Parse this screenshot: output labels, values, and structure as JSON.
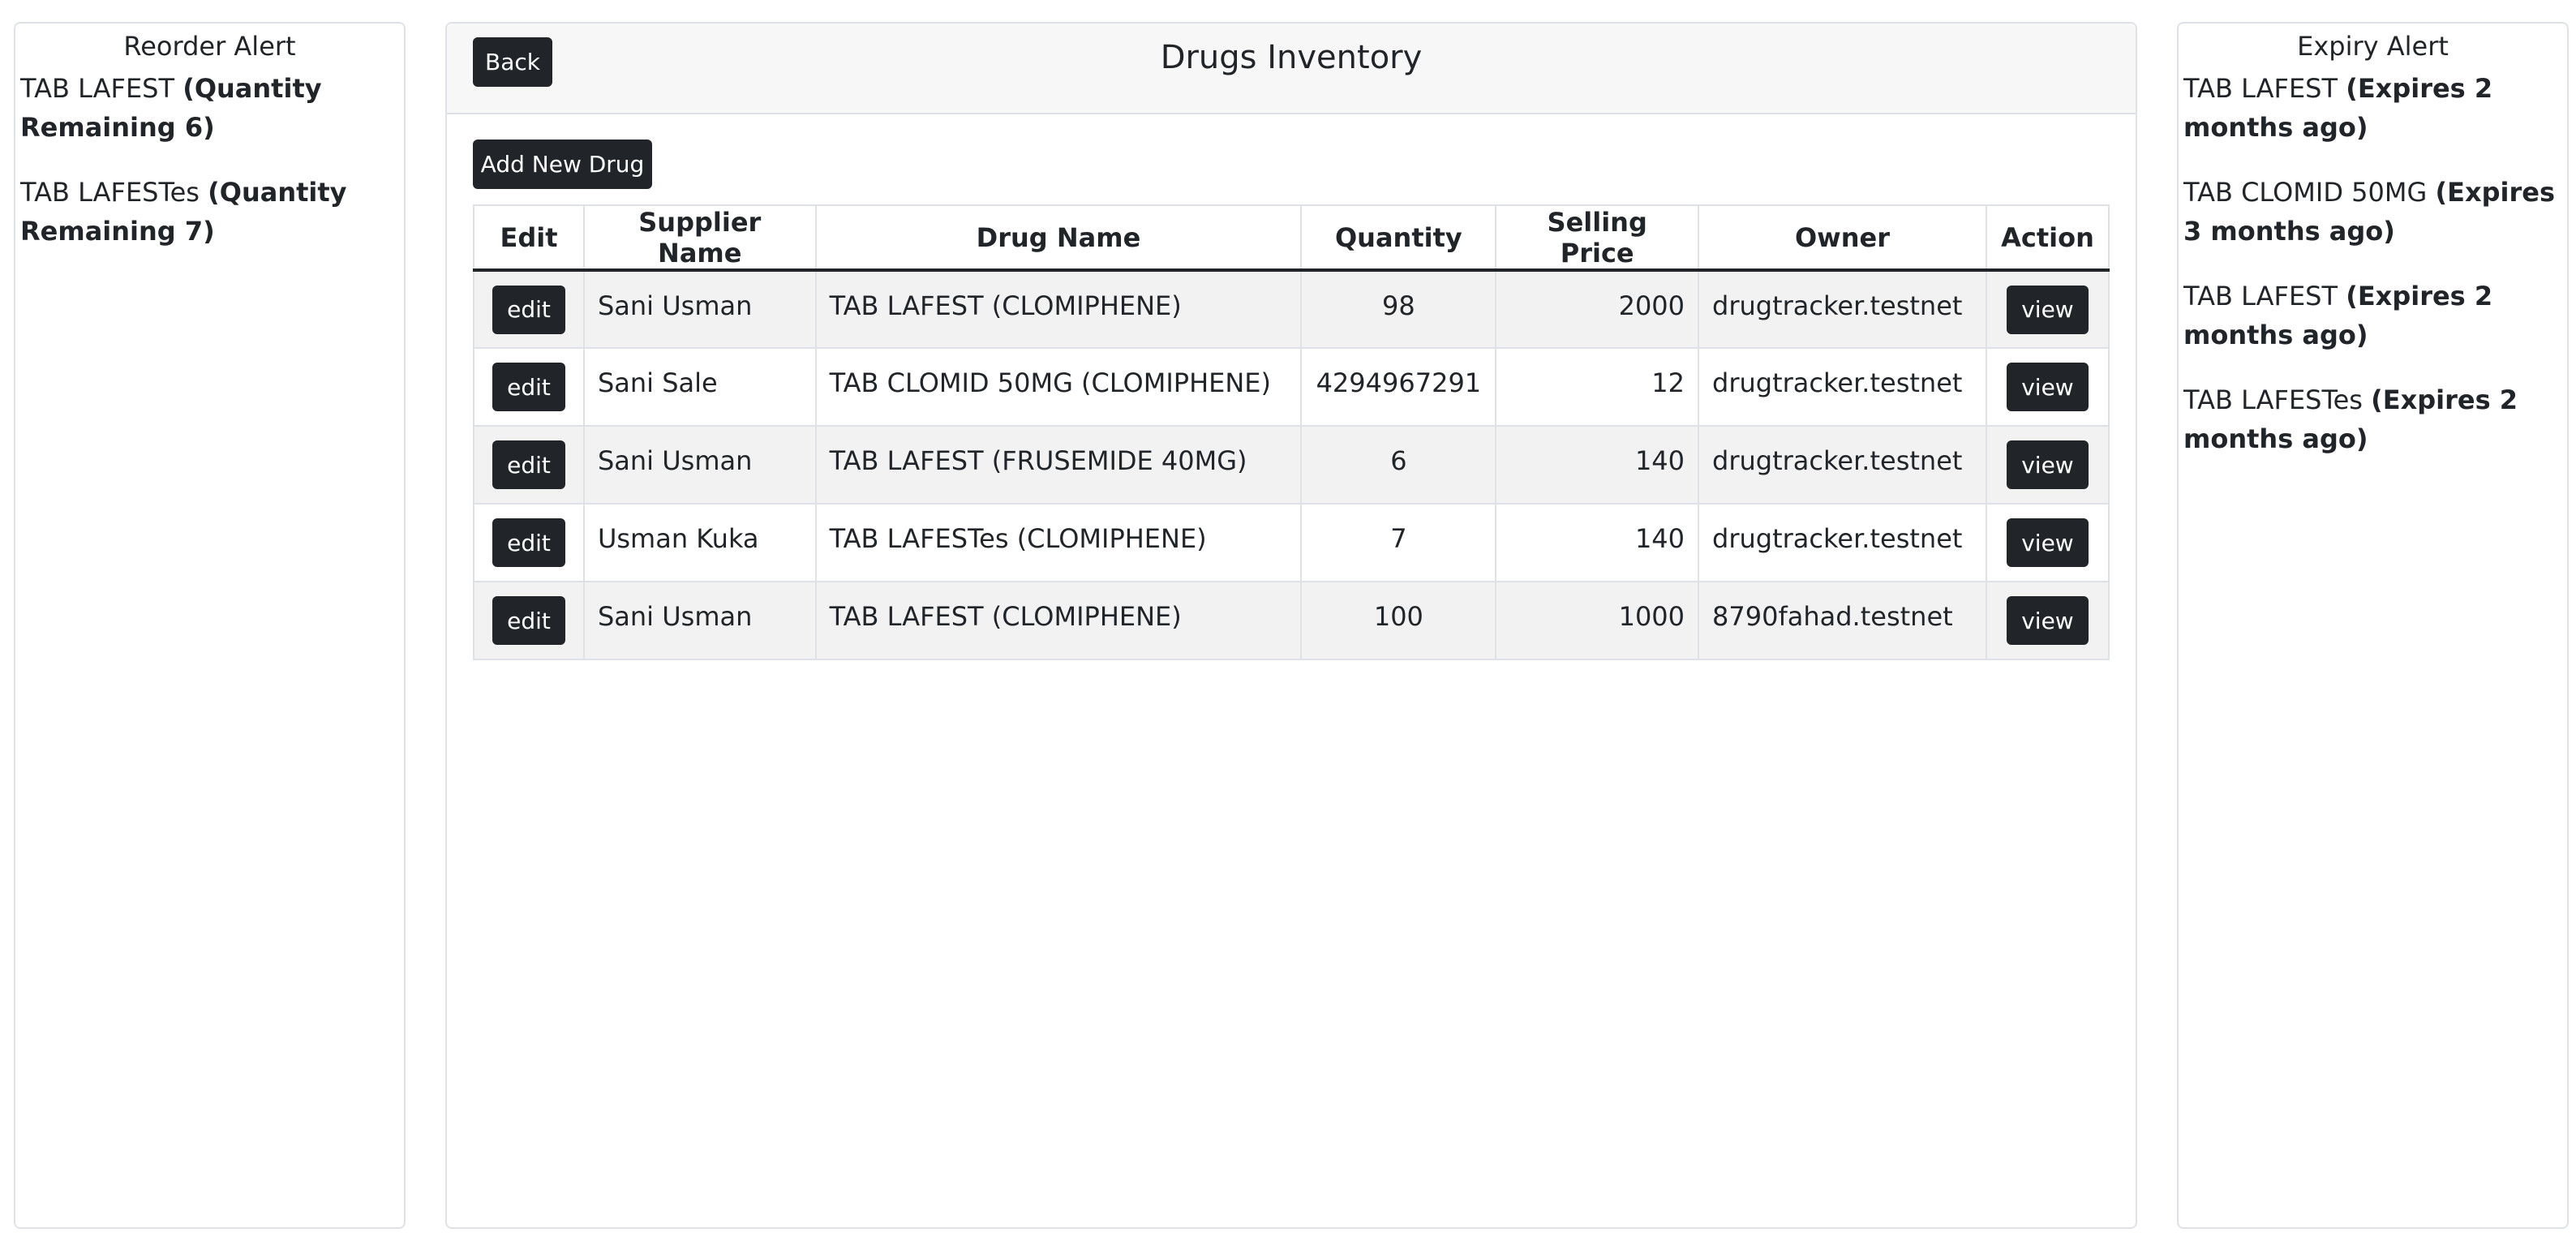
{
  "reorder_alert": {
    "title": "Reorder Alert",
    "items": [
      {
        "name": "TAB LAFEST",
        "detail": "(Quantity Remaining 6)"
      },
      {
        "name": "TAB LAFESTes",
        "detail": "(Quantity Remaining 7)"
      }
    ]
  },
  "header": {
    "back_label": "Back",
    "title": "Drugs Inventory"
  },
  "toolbar": {
    "add_label": "Add New Drug"
  },
  "table": {
    "columns": [
      "Edit",
      "Supplier Name",
      "Drug Name",
      "Quantity",
      "Selling Price",
      "Owner",
      "Action"
    ],
    "edit_label": "edit",
    "view_label": "view",
    "rows": [
      {
        "supplier": "Sani Usman",
        "drug": "TAB LAFEST (CLOMIPHENE)",
        "quantity": "98",
        "price": "2000",
        "owner": "drugtracker.testnet"
      },
      {
        "supplier": "Sani Sale",
        "drug": "TAB CLOMID 50MG (CLOMIPHENE)",
        "quantity": "4294967291",
        "price": "12",
        "owner": "drugtracker.testnet"
      },
      {
        "supplier": "Sani Usman",
        "drug": "TAB LAFEST (FRUSEMIDE 40MG)",
        "quantity": "6",
        "price": "140",
        "owner": "drugtracker.testnet"
      },
      {
        "supplier": "Usman Kuka",
        "drug": "TAB LAFESTes (CLOMIPHENE)",
        "quantity": "7",
        "price": "140",
        "owner": "drugtracker.testnet"
      },
      {
        "supplier": "Sani Usman",
        "drug": "TAB LAFEST (CLOMIPHENE)",
        "quantity": "100",
        "price": "1000",
        "owner": "8790fahad.testnet"
      }
    ]
  },
  "expiry_alert": {
    "title": "Expiry Alert",
    "items": [
      {
        "name": "TAB LAFEST",
        "detail": "(Expires 2 months ago)"
      },
      {
        "name": "TAB CLOMID 50MG",
        "detail": "(Expires 3 months ago)"
      },
      {
        "name": "TAB LAFEST",
        "detail": "(Expires 2 months ago)"
      },
      {
        "name": "TAB LAFESTes",
        "detail": "(Expires 2 months ago)"
      }
    ]
  }
}
